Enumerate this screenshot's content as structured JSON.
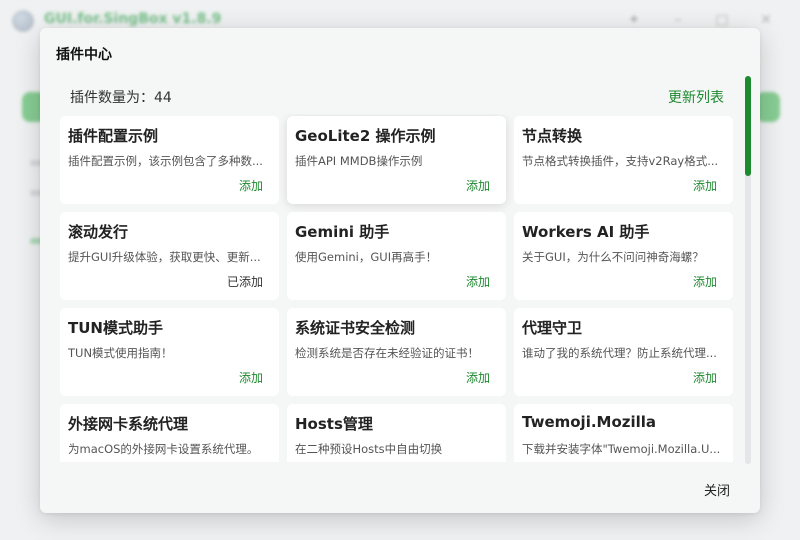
{
  "app": {
    "title": "GUI.for.SingBox v1.8.9",
    "window_controls": [
      "pin-icon",
      "minimize-icon",
      "maximize-icon",
      "close-icon"
    ]
  },
  "modal": {
    "title": "插件中心",
    "count_label": "插件数量为：44",
    "refresh_label": "更新列表",
    "close_label": "关闭",
    "plugins": [
      {
        "name": "插件配置示例",
        "desc": "插件配置示例，该示例包含了多种数...",
        "action": "添加"
      },
      {
        "name": "GeoLite2 操作示例",
        "desc": "插件API MMDB操作示例",
        "action": "添加"
      },
      {
        "name": "节点转换",
        "desc": "节点格式转换插件，支持v2Ray格式...",
        "action": "添加"
      },
      {
        "name": "滚动发行",
        "desc": "提升GUI升级体验，获取更快、更新...",
        "action": "已添加"
      },
      {
        "name": "Gemini 助手",
        "desc": "使用Gemini，GUI再高手！",
        "action": "添加"
      },
      {
        "name": "Workers AI 助手",
        "desc": "关于GUI，为什么不问问神奇海螺？",
        "action": "添加"
      },
      {
        "name": "TUN模式助手",
        "desc": "TUN模式使用指南！",
        "action": "添加"
      },
      {
        "name": "系统证书安全检测",
        "desc": "检测系统是否存在未经验证的证书！",
        "action": "添加"
      },
      {
        "name": "代理守卫",
        "desc": "谁动了我的系统代理？防止系统代理...",
        "action": "添加"
      },
      {
        "name": "外接网卡系统代理",
        "desc": "为macOS的外接网卡设置系统代理。",
        "action": ""
      },
      {
        "name": "Hosts管理",
        "desc": "在二种预设Hosts中自由切换",
        "action": ""
      },
      {
        "name": "Twemoji.Mozilla",
        "desc": "下载并安装字体\"Twemoji.Mozilla.U...",
        "action": ""
      }
    ]
  },
  "colors": {
    "accent": "#1d8a2f",
    "card_bg": "#ffffff",
    "modal_bg": "#f5f6f6"
  }
}
